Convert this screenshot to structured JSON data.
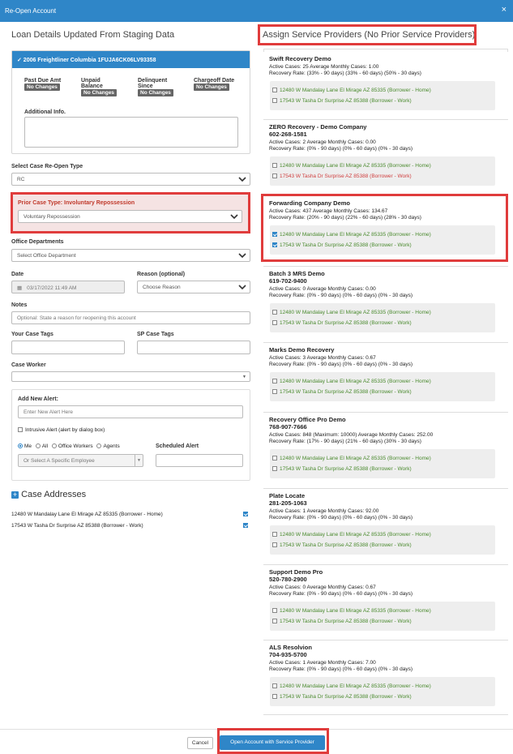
{
  "window": {
    "title": "Re-Open Account",
    "close_glyph": "×"
  },
  "left": {
    "heading": "Loan Details Updated From Staging Data",
    "vehicle_card": {
      "title": "✓ 2006 Freightliner Columbia 1FUJA6CK06LV93358",
      "fields": [
        {
          "label": "Past Due Amt",
          "label2": "",
          "value": "No Changes"
        },
        {
          "label": "Unpaid",
          "label2": "Balance",
          "value": "No Changes"
        },
        {
          "label": "Delinquent",
          "label2": "Since",
          "value": "No Changes"
        },
        {
          "label": "Chargeoff Date",
          "label2": "",
          "value": "No Changes"
        }
      ],
      "additional_info_label": "Additional Info."
    },
    "reopen_type": {
      "label": "Select Case Re-Open Type",
      "value": "RC"
    },
    "prior_case": {
      "label": "Prior Case Type: Involuntary Repossession",
      "value": "Voluntary Repossession"
    },
    "office_departments": {
      "label": "Office Departments",
      "placeholder": "Select Office Department"
    },
    "date": {
      "label": "Date",
      "value": "03/17/2022 11:49 AM"
    },
    "reason": {
      "label": "Reason (optional)",
      "placeholder": "Choose Reason"
    },
    "notes": {
      "label": "Notes",
      "placeholder": "Optional: State a reason for reopening this account"
    },
    "your_case_tags": {
      "label": "Your Case Tags"
    },
    "sp_case_tags": {
      "label": "SP Case Tags"
    },
    "case_worker": {
      "label": "Case Worker"
    },
    "alert": {
      "label": "Add New Alert:",
      "placeholder": "Enter New Alert Here",
      "intrusive_label": "Intrusive Alert (alert by dialog box)",
      "radios": [
        "Me",
        "All",
        "Office Workers",
        "Agents"
      ],
      "employee_placeholder": "Or Select A Specific Employee",
      "scheduled_label": "Scheduled Alert"
    },
    "case_addresses": {
      "heading": "Case Addresses",
      "items": [
        "12480 W Mandalay Lane El Mirage AZ 85335 (Borrower - Home)",
        "17543 W Tasha Dr Surprise AZ 85388 (Borrower - Work)"
      ]
    }
  },
  "right": {
    "heading": "Assign Service Providers (No Prior Service Providers)",
    "providers": [
      {
        "name": "Swift Recovery Demo",
        "phone": "",
        "active": "Active Cases: 25 Average Monthly Cases: 1.00",
        "rate": "Recovery Rate: (33% - 90 days) (33% - 60 days) (50% - 30 days)",
        "addresses": [
          "12480 W Mandalay Lane El Mirage AZ 85335 (Borrower - Home)",
          "17543 W Tasha Dr Surprise AZ 85388 (Borrower - Work)"
        ],
        "checked": [
          false,
          false
        ],
        "second_red": false
      },
      {
        "name": "ZERO Recovery - Demo Company",
        "phone": "602-268-1581",
        "active": "Active Cases: 2 Average Monthly Cases: 0.00",
        "rate": "Recovery Rate: (0% - 90 days) (0% - 60 days) (0% - 30 days)",
        "addresses": [
          "12480 W Mandalay Lane El Mirage AZ 85335 (Borrower - Home)",
          "17543 W Tasha Dr Surprise AZ 85388 (Borrower - Work)"
        ],
        "checked": [
          false,
          false
        ],
        "second_red": true
      },
      {
        "name": "Forwarding Company Demo",
        "phone": "",
        "active": "Active Cases: 437 Average Monthly Cases: 134.67",
        "rate": "Recovery Rate: (20% - 90 days) (22% - 60 days) (28% - 30 days)",
        "addresses": [
          "12480 W Mandalay Lane El Mirage AZ 85335 (Borrower - Home)",
          "17543 W Tasha Dr Surprise AZ 85388 (Borrower - Work)"
        ],
        "checked": [
          true,
          true
        ],
        "second_red": false
      },
      {
        "name": "Batch 3 MRS Demo",
        "phone": "619-702-9400",
        "active": "Active Cases: 0 Average Monthly Cases: 0.00",
        "rate": "Recovery Rate: (0% - 90 days) (0% - 60 days) (0% - 30 days)",
        "addresses": [
          "12480 W Mandalay Lane El Mirage AZ 85335 (Borrower - Home)",
          "17543 W Tasha Dr Surprise AZ 85388 (Borrower - Work)"
        ],
        "checked": [
          false,
          false
        ],
        "second_red": false
      },
      {
        "name": "Marks Demo Recovery",
        "phone": "",
        "active": "Active Cases: 3 Average Monthly Cases: 0.67",
        "rate": "Recovery Rate: (0% - 90 days) (0% - 60 days) (0% - 30 days)",
        "addresses": [
          "12480 W Mandalay Lane El Mirage AZ 85335 (Borrower - Home)",
          "17543 W Tasha Dr Surprise AZ 85388 (Borrower - Work)"
        ],
        "checked": [
          false,
          false
        ],
        "second_red": false
      },
      {
        "name": "Recovery Office Pro Demo",
        "phone": "768-907-7666",
        "active": "Active Cases: 848 (Maximum: 10000) Average Monthly Cases: 252.00",
        "rate": "Recovery Rate: (17% - 90 days) (21% - 60 days) (30% - 30 days)",
        "addresses": [
          "12480 W Mandalay Lane El Mirage AZ 85335 (Borrower - Home)",
          "17543 W Tasha Dr Surprise AZ 85388 (Borrower - Work)"
        ],
        "checked": [
          false,
          false
        ],
        "second_red": false
      },
      {
        "name": "Plate Locate",
        "phone": "281-205-1063",
        "active": "Active Cases: 1 Average Monthly Cases: 92.00",
        "rate": "Recovery Rate: (0% - 90 days) (0% - 60 days) (0% - 30 days)",
        "addresses": [
          "12480 W Mandalay Lane El Mirage AZ 85335 (Borrower - Home)",
          "17543 W Tasha Dr Surprise AZ 85388 (Borrower - Work)"
        ],
        "checked": [
          false,
          false
        ],
        "second_red": false
      },
      {
        "name": "Support Demo Pro",
        "phone": "520-780-2900",
        "active": "Active Cases: 0 Average Monthly Cases: 0.67",
        "rate": "Recovery Rate: (0% - 90 days) (0% - 60 days) (0% - 30 days)",
        "addresses": [
          "12480 W Mandalay Lane El Mirage AZ 85335 (Borrower - Home)",
          "17543 W Tasha Dr Surprise AZ 85388 (Borrower - Work)"
        ],
        "checked": [
          false,
          false
        ],
        "second_red": false
      },
      {
        "name": "ALS Resolvion",
        "phone": "704-935-5700",
        "active": "Active Cases: 1 Average Monthly Cases: 7.00",
        "rate": "Recovery Rate: (0% - 90 days) (0% - 60 days) (0% - 30 days)",
        "addresses": [
          "12480 W Mandalay Lane El Mirage AZ 85335 (Borrower - Home)",
          "17543 W Tasha Dr Surprise AZ 85388 (Borrower - Work)"
        ],
        "checked": [
          false,
          false
        ],
        "second_red": false
      }
    ]
  },
  "footer": {
    "cancel_label": "Cancel",
    "submit_label": "Open Account with Service Provider"
  },
  "colors": {
    "primary": "#2f86c8",
    "highlight": "#e03c3c",
    "address_green": "#4a8a2e",
    "address_red": "#d04040"
  }
}
